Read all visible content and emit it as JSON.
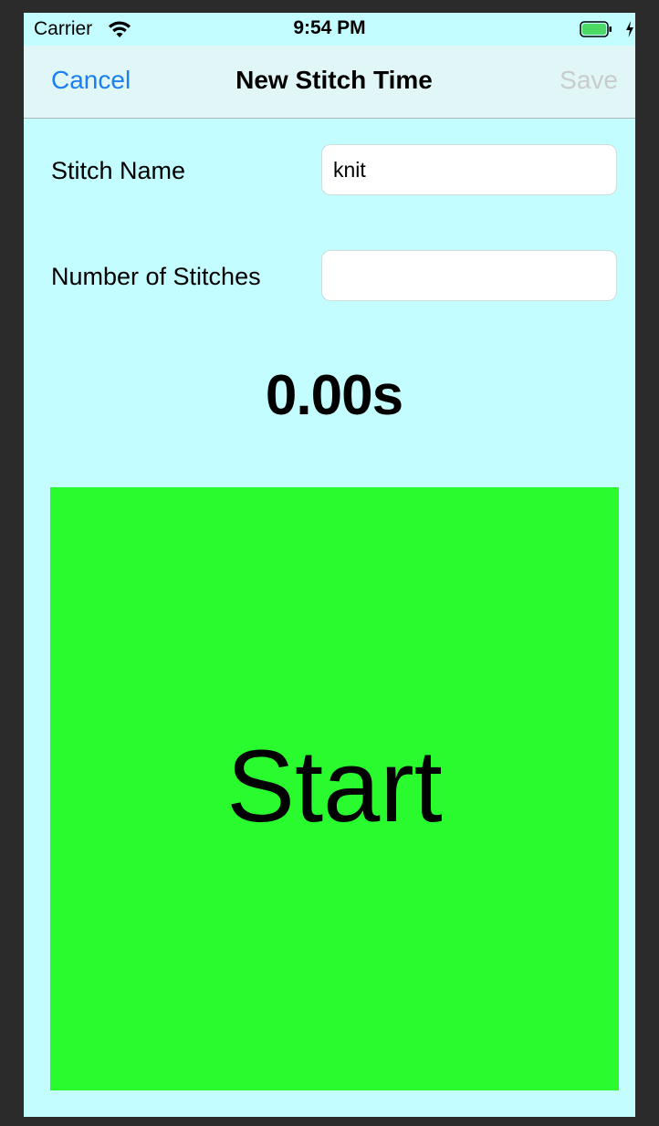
{
  "status_bar": {
    "carrier": "Carrier",
    "time": "9:54 PM",
    "wifi_icon": "wifi-icon",
    "battery_icon": "battery-full-icon",
    "charging_icon": "charging-bolt-icon"
  },
  "nav": {
    "cancel_label": "Cancel",
    "title": "New Stitch Time",
    "save_label": "Save",
    "cancel_color": "#1a7ff0",
    "save_color_disabled": "#c8cccc"
  },
  "form": {
    "stitch_name_label": "Stitch Name",
    "stitch_name_value": "knit",
    "stitch_count_label": "Number of Stitches",
    "stitch_count_value": ""
  },
  "timer": {
    "display": "0.00s"
  },
  "start_button": {
    "label": "Start",
    "color": "#2afb2f"
  },
  "colors": {
    "background": "#c3fdff",
    "nav_background": "#e1f7f7"
  }
}
